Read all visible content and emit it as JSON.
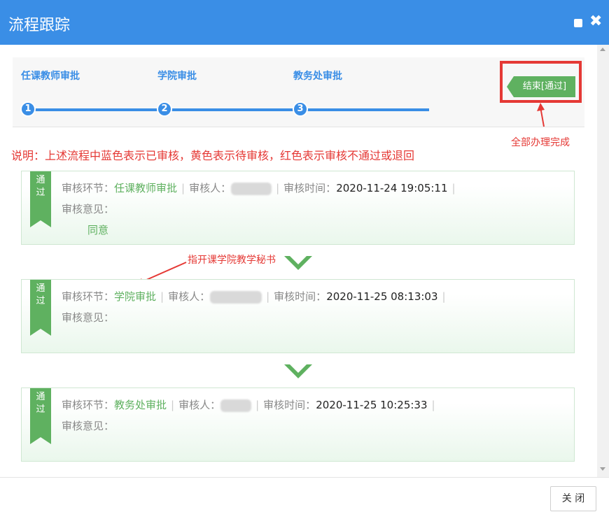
{
  "dialog": {
    "title": "流程跟踪",
    "close_button": "关 闭"
  },
  "flow": {
    "steps": [
      {
        "number": "1",
        "label": "任课教师审批"
      },
      {
        "number": "2",
        "label": "学院审批"
      },
      {
        "number": "3",
        "label": "教务处审批"
      }
    ],
    "end_tag": "结束[通过]",
    "end_note": "全部办理完成"
  },
  "explanation": "说明：上述流程中蓝色表示已审核，黄色表示待审核，红色表示审核不通过或退回",
  "annotation": "指开课学院教学秘书",
  "labels": {
    "status": "通过",
    "stage": "审核环节：",
    "reviewer": "审核人：",
    "time": "审核时间：",
    "opinion": "审核意见："
  },
  "records": [
    {
      "stage": "任课教师审批",
      "time": "2020-11-24 19:05:11",
      "opinion": "同意"
    },
    {
      "stage": "学院审批",
      "time": "2020-11-25 08:13:03",
      "opinion": ""
    },
    {
      "stage": "教务处审批",
      "time": "2020-11-25 10:25:33",
      "opinion": ""
    }
  ],
  "colors": {
    "accent": "#3a8ee6",
    "pass": "#5fb160",
    "alert": "#e53935"
  }
}
